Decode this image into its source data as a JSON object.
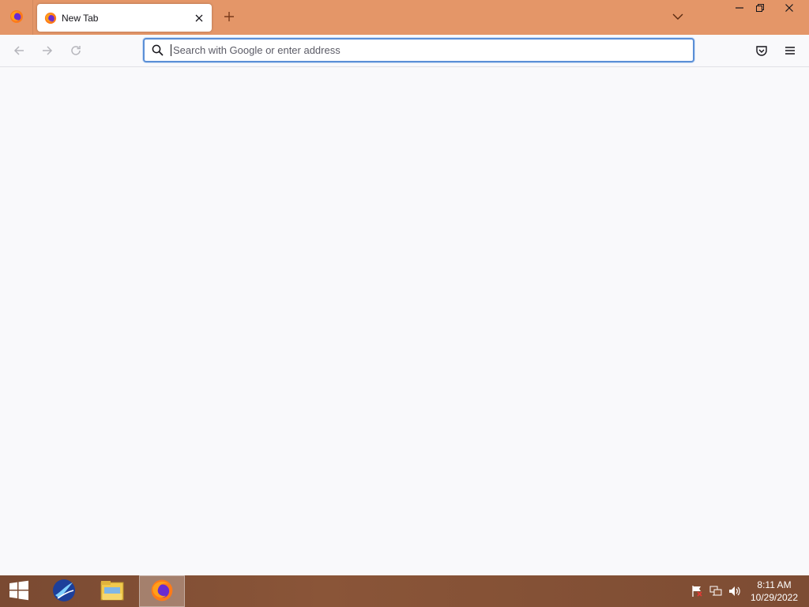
{
  "browser": {
    "tab": {
      "title": "New Tab"
    },
    "urlbar": {
      "placeholder": "Search with Google or enter address",
      "value": ""
    }
  },
  "taskbar": {
    "clock": {
      "time": "8:11 AM",
      "date": "10/29/2022"
    }
  },
  "colors": {
    "titlebar": "#e49668",
    "toolbar": "#f9f9fb",
    "focus_ring": "#5b8fd6",
    "taskbar": "#7a4a32"
  },
  "icons": {
    "firefox_menu": "firefox-logo-icon",
    "tab_favicon": "firefox-logo-icon",
    "tab_close": "close-icon",
    "new_tab": "plus-icon",
    "list_tabs": "chevron-down-icon",
    "minimize": "minimize-icon",
    "restore": "restore-icon",
    "close_window": "close-icon",
    "back": "arrow-left-icon",
    "forward": "arrow-right-icon",
    "reload": "reload-icon",
    "search": "search-icon",
    "pocket": "pocket-icon",
    "app_menu": "hamburger-menu-icon",
    "start": "windows-logo-icon",
    "taskbar_app": "bird-app-icon",
    "file_explorer": "folder-icon",
    "firefox_taskbar": "firefox-logo-icon",
    "tray_flag": "action-center-flag-icon",
    "tray_network": "network-icon",
    "tray_volume": "volume-icon"
  }
}
